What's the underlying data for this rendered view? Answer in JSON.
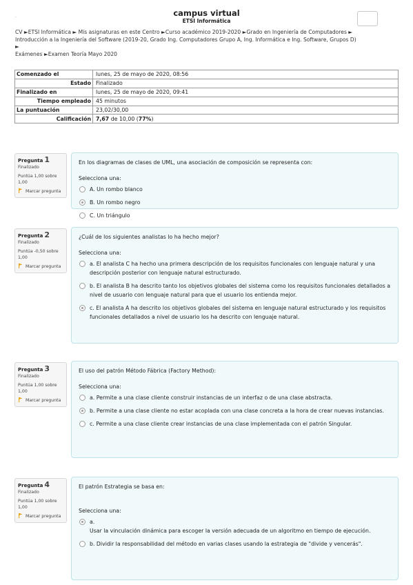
{
  "header": {
    "title": "campus virtual",
    "subtitle": "ETSI Informática",
    "dot": "."
  },
  "breadcrumb": {
    "line1": "CV ►ETSI Informática ► Mis asignaturas en este Centro ►Curso académico 2019-2020 ►Grado en Ingeniería de Computadores ►",
    "line2": "Introducción a la Ingeniería del Software (2019-20, Grado Ing. Computadores Grupo A, Ing. Informática e Ing. Software, Grupos D)",
    "line3": "►",
    "line4": "Exámenes ►Examen Teoría Mayo 2020"
  },
  "summary": [
    {
      "key": "Comenzado el",
      "value": "lunes, 25 de mayo de 2020, 08:56"
    },
    {
      "key": "Estado",
      "value": "Finalizado"
    },
    {
      "key": "Finalizado en",
      "value": "lunes, 25 de mayo de 2020, 09:41"
    },
    {
      "key": "Tiempo empleado",
      "value": "45 minutos"
    },
    {
      "key": "La puntuación",
      "value": "23,02/30,00"
    },
    {
      "key": "Calificación",
      "value_bold": "7,67",
      "value_mid": " de 10,00 (",
      "value_pct": "77%",
      "value_end": ")"
    }
  ],
  "colors": {
    "question_bg": "#f1fafb",
    "question_border": "#bde3e8",
    "info_bg": "#f6f6f6",
    "flag": "#e8a317"
  },
  "questions": [
    {
      "label": "Pregunta",
      "number": "1",
      "state": "Finalizado",
      "score": "Puntúa 1,00 sobre 1,00",
      "flag": "Marcar pregunta",
      "text": "En los diagramas de clases de UML, una asociación de composición se representa con:",
      "prompt": "Selecciona una:",
      "options": [
        "A. Un rombo blanco",
        "B. Un rombo negro",
        "C. Un triángulo"
      ],
      "selected": 1
    },
    {
      "label": "Pregunta",
      "number": "2",
      "state": "Finalizado",
      "score": "Puntúa -0,50 sobre 1,00",
      "flag": "Marcar pregunta",
      "text": "¿Cuál de los siguientes analistas lo ha hecho mejor?",
      "prompt": "Selecciona una:",
      "options": [
        "a. El analista C ha hecho una primera descripción de los requisitos funcionales con lenguaje natural y una descripción posterior con lenguaje natural estructurado.",
        "b. El analista B ha descrito tanto los objetivos globales del sistema como los requisitos funcionales detallados a nivel de usuario con lenguaje natural para que el usuario los entienda mejor.",
        "c. El analista A ha descrito los objetivos globales del sistema en lenguaje natural estructurado y los requisitos funcionales detallados a nivel de usuario los ha descrito con lenguaje natural."
      ],
      "selected": 2
    },
    {
      "label": "Pregunta",
      "number": "3",
      "state": "Finalizado",
      "score": "Puntúa 1,00 sobre 1,00",
      "flag": "Marcar pregunta",
      "text": "El uso del patrón Método Fábrica (Factory Method):",
      "prompt": "Selecciona una:",
      "options": [
        "a. Permite a una clase cliente construir instancias de un interfaz o de una clase abstracta.",
        "b. Permite a una clase cliente no estar acoplada con una clase concreta a la hora de crear nuevas instancias.",
        "c. Permite a una clase cliente crear instancias de una clase implementada con el patrón Singular."
      ],
      "selected": 1
    },
    {
      "label": "Pregunta",
      "number": "4",
      "state": "Finalizado",
      "score": "Puntúa 1,00 sobre 1,00",
      "flag": "Marcar pregunta",
      "text": "El patrón Estrategia se basa en:",
      "prompt": "Selecciona una:",
      "options": [
        "a.",
        "b. Dividir la responsabilidad del método en varias clases usando la estrategia de \"divide y vencerás\"."
      ],
      "option_a_detail": "Usar la vinculación dinámica para escoger la versión adecuada de un algoritmo en tiempo de ejecución.",
      "selected": 0
    }
  ]
}
